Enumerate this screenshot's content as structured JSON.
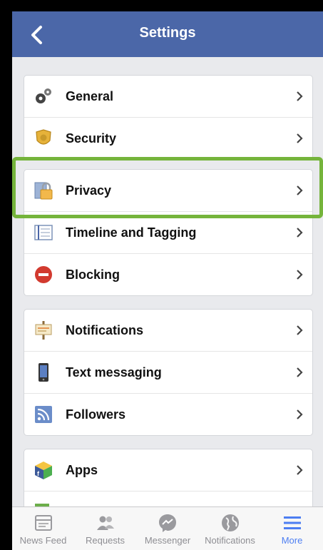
{
  "header": {
    "title": "Settings"
  },
  "groups": [
    {
      "items": [
        {
          "label": "General",
          "icon": "gears-icon"
        },
        {
          "label": "Security",
          "icon": "shield-badge-icon"
        }
      ]
    },
    {
      "items": [
        {
          "label": "Privacy",
          "icon": "padlock-icon"
        },
        {
          "label": "Timeline and Tagging",
          "icon": "timeline-icon"
        },
        {
          "label": "Blocking",
          "icon": "block-icon"
        }
      ]
    },
    {
      "items": [
        {
          "label": "Notifications",
          "icon": "notification-board-icon"
        },
        {
          "label": "Text messaging",
          "icon": "phone-icon"
        },
        {
          "label": "Followers",
          "icon": "rss-icon"
        }
      ]
    },
    {
      "items": [
        {
          "label": "Apps",
          "icon": "apps-cube-icon"
        }
      ]
    }
  ],
  "tabbar": {
    "tabs": [
      {
        "label": "News Feed",
        "icon": "news-feed-icon",
        "active": false
      },
      {
        "label": "Requests",
        "icon": "friends-icon",
        "active": false
      },
      {
        "label": "Messenger",
        "icon": "messenger-icon",
        "active": false
      },
      {
        "label": "Notifications",
        "icon": "globe-icon",
        "active": false
      },
      {
        "label": "More",
        "icon": "menu-icon",
        "active": true
      }
    ]
  },
  "colors": {
    "navbar": "#4b67a8",
    "highlight": "#75b43b",
    "active_tab": "#4d7ef2"
  }
}
